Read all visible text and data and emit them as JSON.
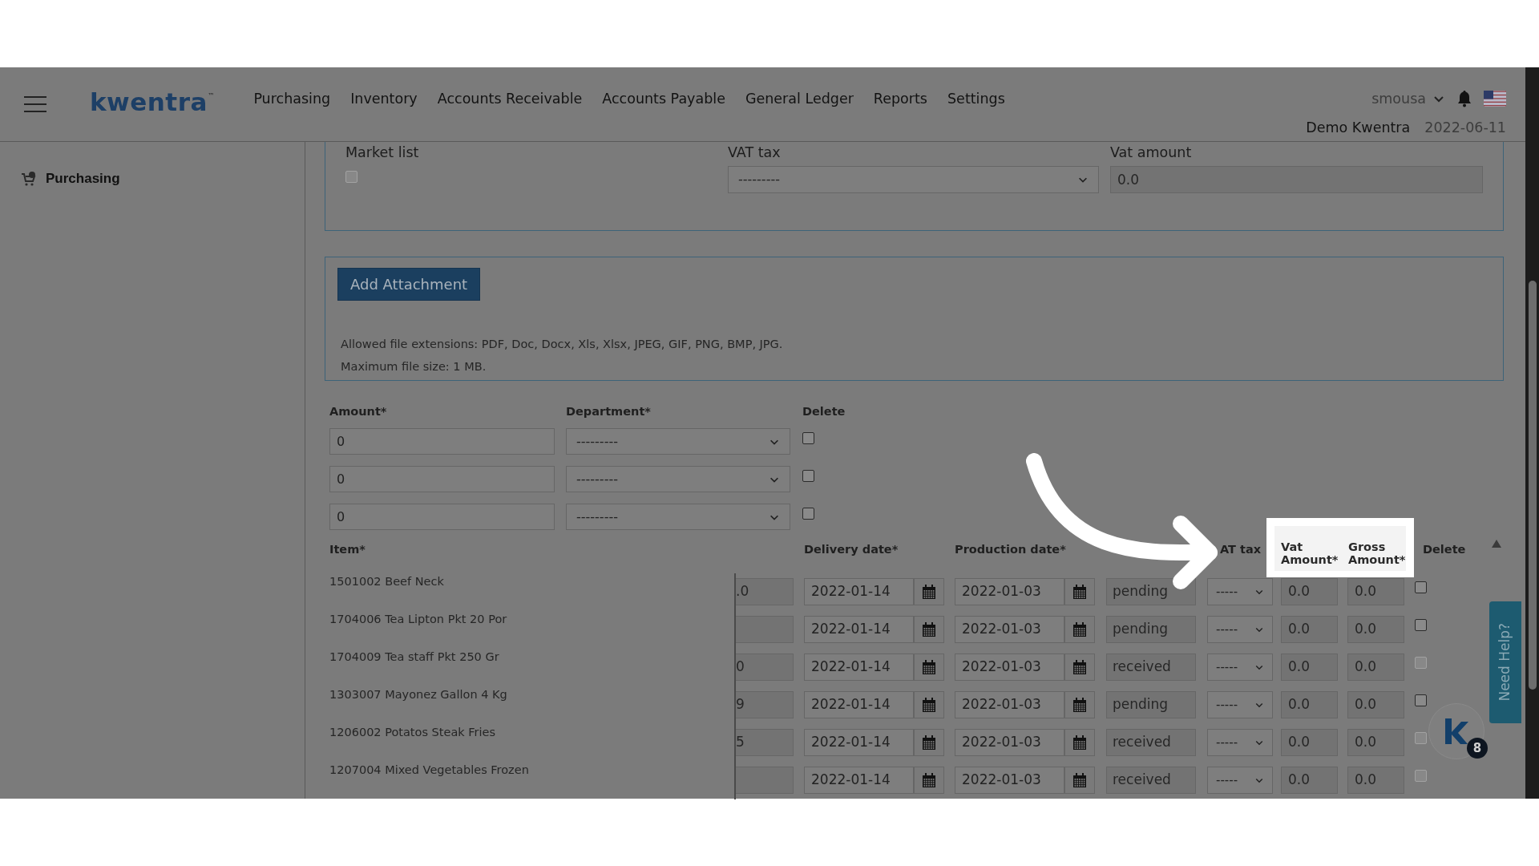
{
  "header": {
    "logo": "kwentra",
    "logo_mark": "™",
    "nav": [
      "Purchasing",
      "Inventory",
      "Accounts Receivable",
      "Accounts Payable",
      "General Ledger",
      "Reports",
      "Settings"
    ],
    "user": "smousa",
    "company": "Demo Kwentra",
    "date": "2022-06-11"
  },
  "sidebar": {
    "items": [
      {
        "label": "Purchasing"
      }
    ]
  },
  "market_card": {
    "market_list": {
      "label": "Market list",
      "checked": false
    },
    "vat_tax": {
      "label": "VAT tax",
      "value": "---------"
    },
    "vat_amount": {
      "label": "Vat amount",
      "value": "0.0"
    }
  },
  "attachments": {
    "button": "Add Attachment",
    "notes": [
      "Allowed file extensions: PDF, Doc, Docx, Xls, Xlsx, JPEG, GIF, PNG, BMP, JPG.",
      "Maximum file size: 1 MB."
    ]
  },
  "departments": {
    "columns": [
      "Amount*",
      "Department*",
      "Delete"
    ],
    "rows": [
      {
        "amount": "0",
        "department": "---------",
        "checked": false
      },
      {
        "amount": "0",
        "department": "---------",
        "checked": false
      },
      {
        "amount": "0",
        "department": "---------",
        "checked": false
      }
    ]
  },
  "items": {
    "columns": {
      "item": "Item*",
      "delivery": "Delivery date*",
      "production": "Production date*",
      "vat_tax": "AT tax",
      "vat_amount": "Vat Amount*",
      "gross_amount": "Gross Amount*",
      "delete": "Delete"
    },
    "rows": [
      {
        "item": "1501002 Beef Neck",
        "quantity": ".0",
        "delivery": "2022-01-14",
        "production": "2022-01-03",
        "status": "pending",
        "vat_tax": "-----",
        "vat_amount": "0.0",
        "gross_amount": "0.0",
        "disabled": false
      },
      {
        "item": "1704006 Tea Lipton Pkt 20 Por",
        "quantity": "",
        "delivery": "2022-01-14",
        "production": "2022-01-03",
        "status": "pending",
        "vat_tax": "-----",
        "vat_amount": "0.0",
        "gross_amount": "0.0",
        "disabled": false
      },
      {
        "item": "1704009 Tea staff Pkt 250 Gr",
        "quantity": "0",
        "delivery": "2022-01-14",
        "production": "2022-01-03",
        "status": "received",
        "vat_tax": "-----",
        "vat_amount": "0.0",
        "gross_amount": "0.0",
        "disabled": true
      },
      {
        "item": "1303007 Mayonez Gallon 4 Kg",
        "quantity": "9",
        "delivery": "2022-01-14",
        "production": "2022-01-03",
        "status": "pending",
        "vat_tax": "-----",
        "vat_amount": "0.0",
        "gross_amount": "0.0",
        "disabled": false
      },
      {
        "item": "1206002 Potatos Steak Fries",
        "quantity": "5",
        "delivery": "2022-01-14",
        "production": "2022-01-03",
        "status": "received",
        "vat_tax": "-----",
        "vat_amount": "0.0",
        "gross_amount": "0.0",
        "disabled": true
      },
      {
        "item": "1207004 Mixed Vegetables Frozen",
        "quantity": "",
        "delivery": "2022-01-14",
        "production": "2022-01-03",
        "status": "received",
        "vat_tax": "-----",
        "vat_amount": "0.0",
        "gross_amount": "0.0",
        "disabled": true
      }
    ]
  },
  "help_tab": "Need Help?",
  "chat_badge": "8"
}
